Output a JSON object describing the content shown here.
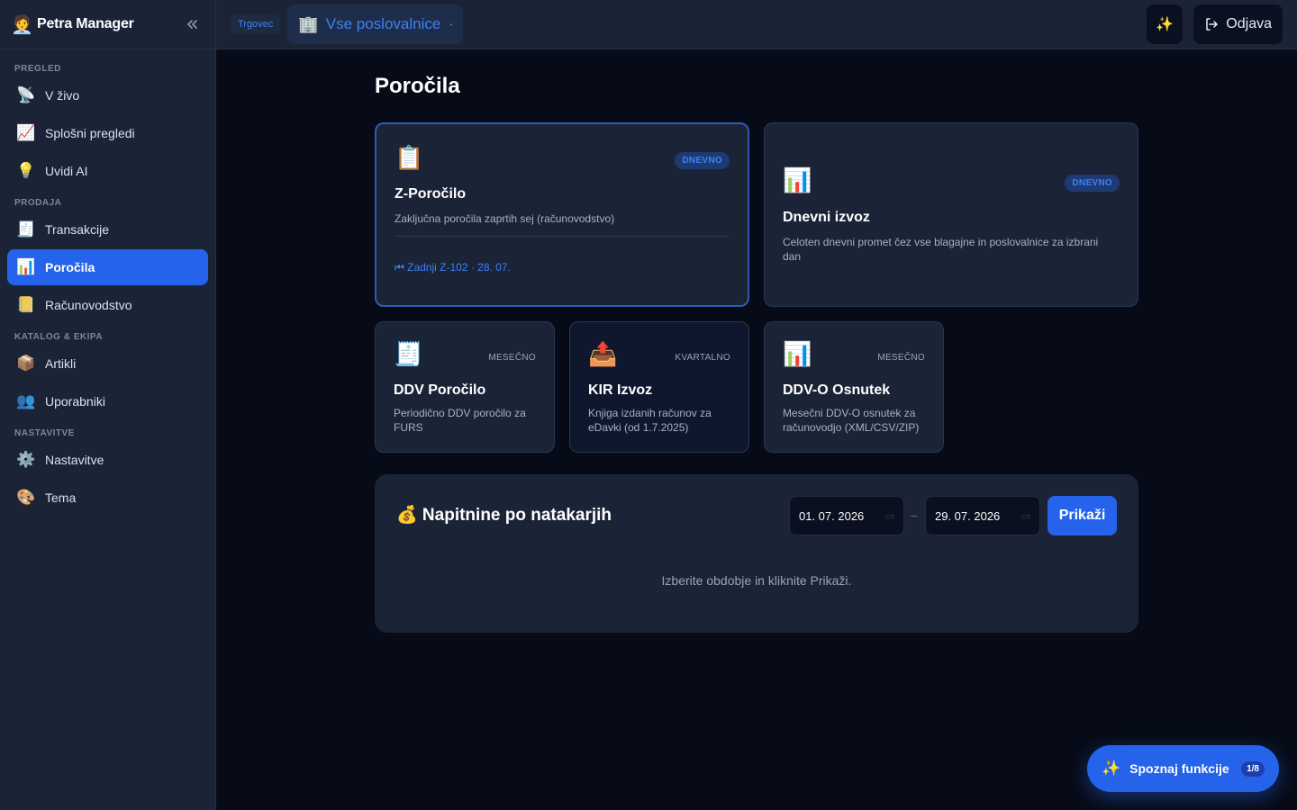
{
  "app": {
    "name": "Petra Manager",
    "logo_icon": "🧑‍💼",
    "collapse_icon": "«"
  },
  "sidebar": {
    "sections": [
      {
        "label": "PREGLED",
        "items": [
          {
            "label": "V živo",
            "icon": "📡"
          },
          {
            "label": "Splošni pregledi",
            "icon": "📈"
          },
          {
            "label": "Uvidi AI",
            "icon": "💡"
          }
        ]
      },
      {
        "label": "PRODAJA",
        "items": [
          {
            "label": "Transakcije",
            "icon": "🧾"
          },
          {
            "label": "Poročila",
            "icon": "📊",
            "active": true
          },
          {
            "label": "Računovodstvo",
            "icon": "📒"
          }
        ]
      },
      {
        "label": "KATALOG & EKIPA",
        "items": [
          {
            "label": "Artikli",
            "icon": "📦"
          },
          {
            "label": "Uporabniki",
            "icon": "👥"
          }
        ]
      },
      {
        "label": "NASTAVITVE",
        "items": [
          {
            "label": "Nastavitve",
            "icon": "⚙️"
          },
          {
            "label": "Tema",
            "icon": "🎨"
          }
        ]
      }
    ]
  },
  "topbar": {
    "role": "Trgovec",
    "location": "Vse poslovalnice",
    "location_icon": "🏢",
    "caret": "•",
    "spark_icon": "✨",
    "logout": "Odjava"
  },
  "page": {
    "title": "Poročila"
  },
  "cards": {
    "z": {
      "icon": "📋",
      "badge": "DNEVNO",
      "title": "Z-Poročilo",
      "desc": "Zaključna poročila zaprtih sej (računovodstvo)",
      "last": "⏮ Zadnji Z-102 · 28. 07."
    },
    "daily": {
      "icon": "📊",
      "badge": "DNEVNO",
      "title": "Dnevni izvoz",
      "desc": "Celoten dnevni promet čez vse blagajne in poslovalnice za izbrani dan"
    },
    "ddv": {
      "icon": "🧾",
      "badge": "MESEČNO",
      "title": "DDV Poročilo",
      "desc": "Periodično DDV poročilo za FURS"
    },
    "kir": {
      "icon": "📤",
      "badge": "KVARTALNO",
      "title": "KIR Izvoz",
      "desc": "Knjiga izdanih računov za eDavki (od 1.7.2025)"
    },
    "ddvo": {
      "icon": "📊",
      "badge": "MESEČNO",
      "title": "DDV-O Osnutek",
      "desc": "Mesečni DDV-O osnutek za računovodjo (XML/CSV/ZIP)"
    }
  },
  "tips": {
    "title": "💰 Napitnine po natakarjih",
    "date_from": "01. 07. 2026",
    "date_to": "29. 07. 2026",
    "dash": "–",
    "show": "Prikaži",
    "empty": "Izberite obdobje in kliknite Prikaži."
  },
  "tour": {
    "icon": "✨",
    "label": "Spoznaj funkcije",
    "count": "1/8"
  },
  "colors": {
    "accent": "#2563eb",
    "sidebar_bg": "#1b2436",
    "main_bg": "#070b17"
  }
}
